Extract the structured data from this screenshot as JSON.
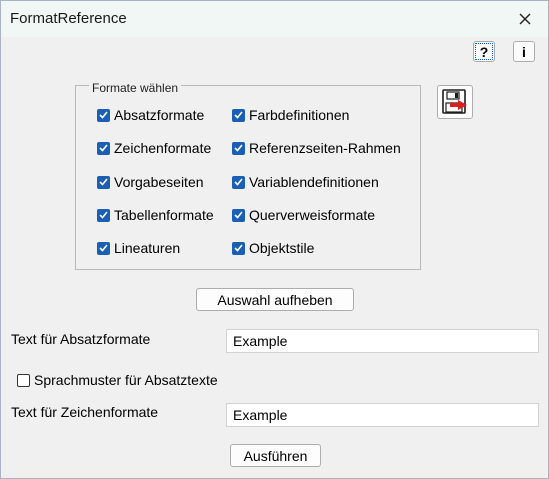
{
  "window": {
    "title": "FormatReference"
  },
  "toolbar": {
    "help_label": "?",
    "info_label": "i"
  },
  "group": {
    "legend": "Formate wählen",
    "left_column": [
      {
        "label": "Absatzformate",
        "checked": true
      },
      {
        "label": "Zeichenformate",
        "checked": true
      },
      {
        "label": "Vorgabeseiten",
        "checked": true
      },
      {
        "label": "Tabellenformate",
        "checked": true
      },
      {
        "label": "Lineaturen",
        "checked": true
      }
    ],
    "right_column": [
      {
        "label": "Farbdefinitionen",
        "checked": true
      },
      {
        "label": "Referenzseiten-Rahmen",
        "checked": true
      },
      {
        "label": "Variablendefinitionen",
        "checked": true
      },
      {
        "label": "Querverweisformate",
        "checked": true
      },
      {
        "label": "Objektstile",
        "checked": true
      }
    ]
  },
  "deselect_button": "Auswahl aufheben",
  "paragraph_text": {
    "label": "Text für Absatzformate",
    "value": "Example"
  },
  "language_pattern": {
    "label": "Sprachmuster für Absatztexte",
    "checked": false
  },
  "character_text": {
    "label": "Text für Zeichenformate",
    "value": "Example"
  },
  "run_button": "Ausführen",
  "colors": {
    "checkbox_accent": "#1a5fb4",
    "titlebar": "#f0f7f4",
    "dialog_bg": "#f0f0f0"
  }
}
